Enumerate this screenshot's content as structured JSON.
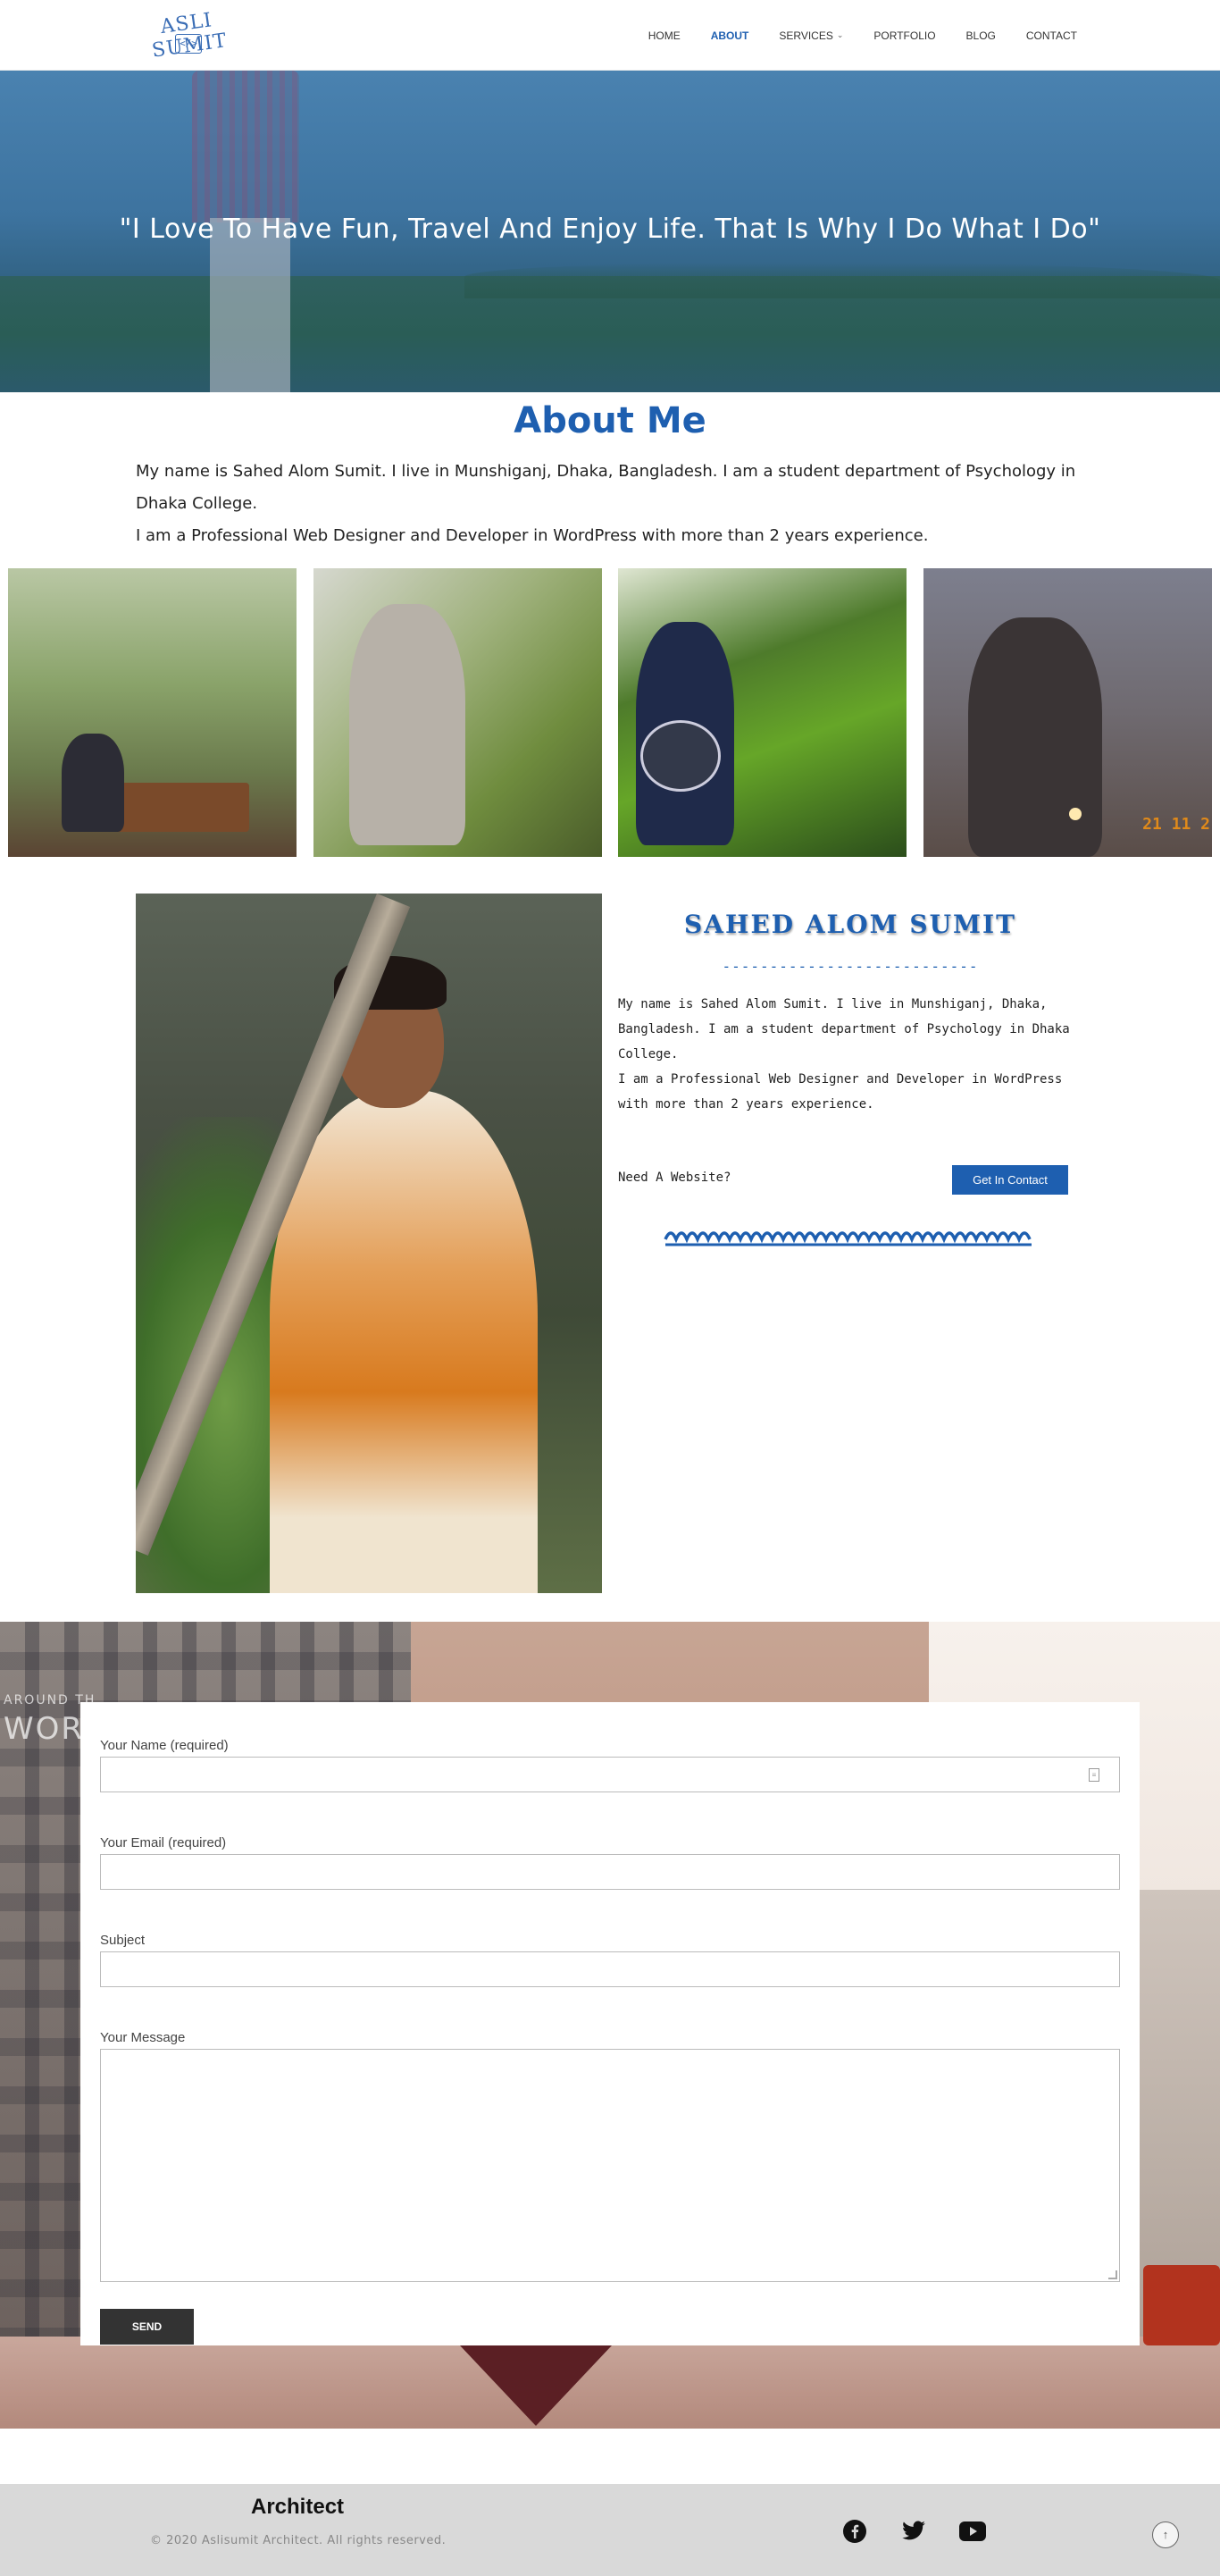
{
  "header": {
    "logo_text": "ASLI SUMIT",
    "logo_code": "</>",
    "nav": [
      {
        "label": "HOME",
        "active": false
      },
      {
        "label": "ABOUT",
        "active": true
      },
      {
        "label": "SERVICES",
        "active": false,
        "has_dropdown": true
      },
      {
        "label": "PORTFOLIO",
        "active": false
      },
      {
        "label": "BLOG",
        "active": false
      },
      {
        "label": "CONTACT",
        "active": false
      }
    ]
  },
  "hero": {
    "quote": "\"I Love To Have Fun, Travel And Enjoy Life. That Is Why I Do What I Do\""
  },
  "about": {
    "title": "About Me",
    "line1": "My name is Sahed Alom Sumit. I live in Munshiganj, Dhaka, Bangladesh. I am a student department of Psychology in Dhaka College.",
    "line2": "I am a Professional Web Designer and Developer in WordPress with more than 2 years experience."
  },
  "gallery": {
    "photo4_date": "21 11 2"
  },
  "profile": {
    "name": "SAHED ALOM SUMIT",
    "dashes": "---------------------------",
    "line1": "My name is Sahed Alom Sumit. I live in Munshiganj, Dhaka, Bangladesh. I am a student department of Psychology in Dhaka College.",
    "line2": "I am a Professional Web Designer and Developer in WordPress with more than 2 years experience.",
    "need_label": "Need A Website?",
    "contact_button": "Get In Contact"
  },
  "form_bg": {
    "world_small": "AROUND TH",
    "world_big": "WORL"
  },
  "form": {
    "name_label": "Your Name (required)",
    "name_value": "",
    "email_label": "Your Email (required)",
    "email_value": "",
    "subject_label": "Subject",
    "subject_value": "",
    "message_label": "Your Message",
    "message_value": "",
    "send_label": "SEND"
  },
  "footer": {
    "title": "Architect",
    "copyright": "© 2020 Aslisumit Architect. All rights reserved.",
    "socials": [
      "facebook-icon",
      "twitter-icon",
      "youtube-icon"
    ],
    "to_top": "↑"
  },
  "colors": {
    "accent": "#1e5fb0",
    "dark_button": "#333333",
    "footer_bg": "#d9d9d9"
  }
}
